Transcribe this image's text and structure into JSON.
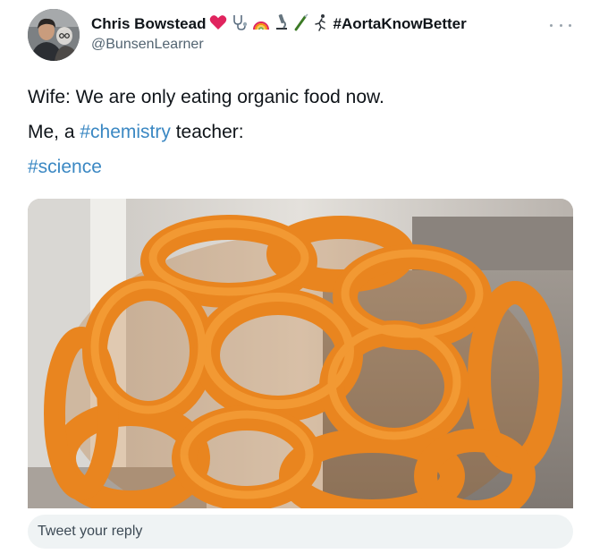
{
  "tweet": {
    "author": {
      "display_name": "Chris Bowstead",
      "name_hashtag": "#AortaKnowBetter",
      "handle": "@BunsenLearner",
      "name_emojis": [
        "heart-icon",
        "stethoscope-icon",
        "rainbow-icon",
        "microscope-icon",
        "syringe-icon",
        "running-person-icon"
      ]
    },
    "more_label": "...",
    "lines": {
      "line1": "Wife: We are only eating organic food now.",
      "line2_prefix": "Me, a ",
      "line2_hashtag": "#chemistry",
      "line2_suffix": " teacher:",
      "line3_hashtag": "#science"
    },
    "media": {
      "icon": "photo-cheese-puff-sculpture"
    }
  },
  "reply": {
    "placeholder": "Tweet your reply"
  },
  "colors": {
    "link": "#1d9bf0",
    "heart": "#e0245e",
    "reply_bg": "#eff3f4",
    "secondary_text": "#536471",
    "puff_orange": "#e9851f"
  }
}
